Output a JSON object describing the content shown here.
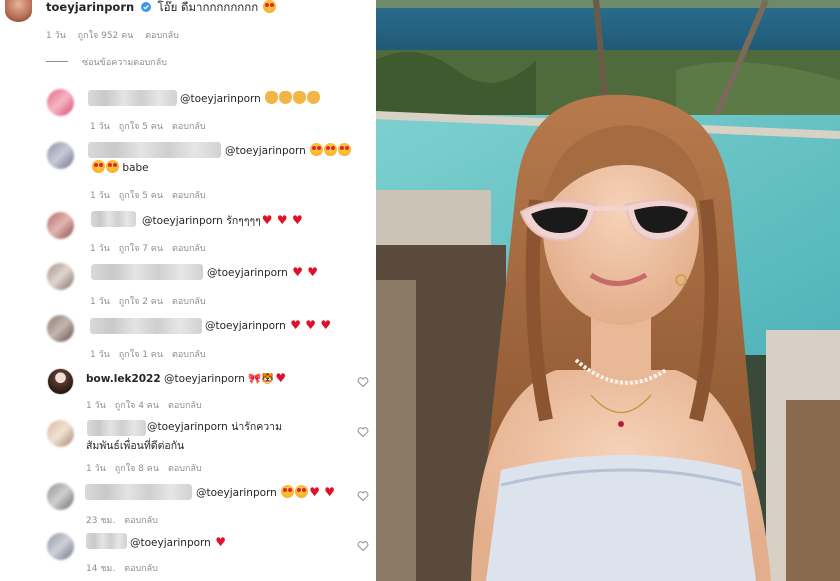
{
  "post": {
    "username": "toeyjarinporn",
    "caption": "โอ๊ย ดีมากกกกกกกก",
    "age": "1 วัน",
    "likes": "ถูกใจ 952 คน",
    "reply": "ตอบกลับ",
    "hide_replies": "ซ่อนข้อความตอบกลับ"
  },
  "comments": [
    {
      "mention": "@toeyjarinporn",
      "text": "",
      "extra": "",
      "age": "1 วัน",
      "likes": "ถูกใจ 5 คน",
      "reply": "ตอบกลับ"
    },
    {
      "mention": "@toeyjarinporn",
      "text": "",
      "extra": "babe",
      "age": "1 วัน",
      "likes": "ถูกใจ 5 คน",
      "reply": "ตอบกลับ"
    },
    {
      "mention": "@toeyjarinporn",
      "text": "รักๆๆๆๆ",
      "extra": "",
      "age": "1 วัน",
      "likes": "ถูกใจ 7 คน",
      "reply": "ตอบกลับ"
    },
    {
      "mention": "@toeyjarinporn",
      "text": "",
      "extra": "",
      "age": "1 วัน",
      "likes": "ถูกใจ 2 คน",
      "reply": "ตอบกลับ"
    },
    {
      "mention": "@toeyjarinporn",
      "text": "",
      "extra": "",
      "age": "1 วัน",
      "likes": "ถูกใจ 1 คน",
      "reply": "ตอบกลับ"
    },
    {
      "username": "bow.lek2022",
      "mention": "@toeyjarinporn",
      "text": "",
      "extra": "",
      "age": "1 วัน",
      "likes": "ถูกใจ 4 คน",
      "reply": "ตอบกลับ"
    },
    {
      "mention": "@toeyjarinporn",
      "text": "น่ารักความสัมพันธ์เพื่อนที่ดีต่อกัน",
      "extra": "",
      "age": "1 วัน",
      "likes": "ถูกใจ 8 คน",
      "reply": "ตอบกลับ"
    },
    {
      "mention": "@toeyjarinporn",
      "text": "",
      "extra": "",
      "age": "23 ชม.",
      "likes": "",
      "reply": "ตอบกลับ"
    },
    {
      "mention": "@toeyjarinporn",
      "text": "",
      "extra": "",
      "age": "14 ชม.",
      "likes": "",
      "reply": "ตอบกลับ"
    }
  ],
  "icons": {
    "verified": "verified-badge-icon",
    "like": "heart-outline-icon"
  },
  "colors": {
    "verified": "#3897f0",
    "meta": "#8e8e8e",
    "text": "#262626",
    "heart": "#e0102a"
  }
}
